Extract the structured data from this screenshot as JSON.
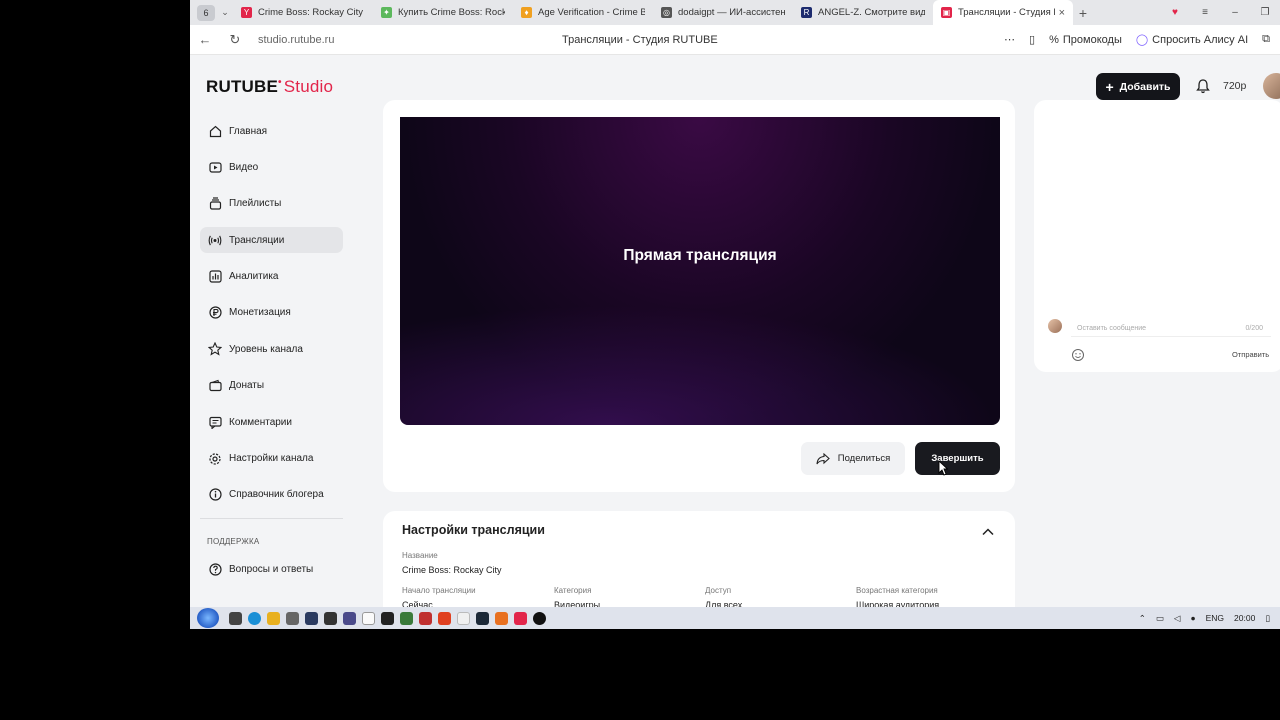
{
  "browser": {
    "tab_counter": "6",
    "tabs": [
      {
        "label": "Crime Boss: Rockay City –",
        "color": "#e2254a",
        "glyph": "Y"
      },
      {
        "label": "Купить Crime Boss: Rockay",
        "color": "#5cb85c",
        "glyph": "✦"
      },
      {
        "label": "Age Verification - Crime B",
        "color": "#f0a020",
        "glyph": "♦"
      },
      {
        "label": "dodaigpt — ИИ-ассистент",
        "color": "#555555",
        "glyph": "◎"
      },
      {
        "label": "ANGEL-Z. Смотрите видео",
        "color": "#1d2b6e",
        "glyph": "R"
      },
      {
        "label": "Трансляции - Студия R",
        "color": "#e2254a",
        "glyph": "▣",
        "active": true
      }
    ],
    "url": "studio.rutube.ru",
    "page_title": "Трансляции - Студия RUTUBE",
    "promo_label": "Промокоды",
    "alice_label": "Спросить Алису AI"
  },
  "header": {
    "logo_main": "RUTUBE",
    "logo_studio": "Studio",
    "add_label": "Добавить",
    "balance": "720р"
  },
  "sidebar": {
    "items": [
      {
        "label": "Главная",
        "icon": "home-icon"
      },
      {
        "label": "Видео",
        "icon": "video-icon"
      },
      {
        "label": "Плейлисты",
        "icon": "playlist-icon"
      },
      {
        "label": "Трансляции",
        "icon": "broadcast-icon",
        "active": true
      },
      {
        "label": "Аналитика",
        "icon": "analytics-icon"
      },
      {
        "label": "Монетизация",
        "icon": "ruble-icon"
      },
      {
        "label": "Уровень канала",
        "icon": "star-icon"
      },
      {
        "label": "Донаты",
        "icon": "wallet-icon"
      },
      {
        "label": "Комментарии",
        "icon": "comment-icon"
      },
      {
        "label": "Настройки канала",
        "icon": "gear-icon"
      },
      {
        "label": "Справочник блогера",
        "icon": "info-icon"
      }
    ],
    "support_heading": "ПОДДЕРЖКА",
    "support_items": [
      {
        "label": "Вопросы и ответы",
        "icon": "help-icon"
      }
    ]
  },
  "player": {
    "overlay_text": "Прямая трансляция",
    "share_label": "Поделиться",
    "finish_label": "Завершить"
  },
  "chat": {
    "placeholder": "Оставить сообщение",
    "counter": "0/200",
    "send_label": "Отправить"
  },
  "settings": {
    "title": "Настройки трансляции",
    "name_label": "Название",
    "name_value": "Crime Boss: Rockay City",
    "start_label": "Начало трансляции",
    "start_value": "Сейчас",
    "category_label": "Категория",
    "category_value": "Видеоигры",
    "access_label": "Доступ",
    "access_value": "Для всех",
    "age_label": "Возрастная категория",
    "age_value": "Широкая аудитория"
  },
  "taskbar": {
    "lang": "ENG",
    "time": "20:00"
  }
}
